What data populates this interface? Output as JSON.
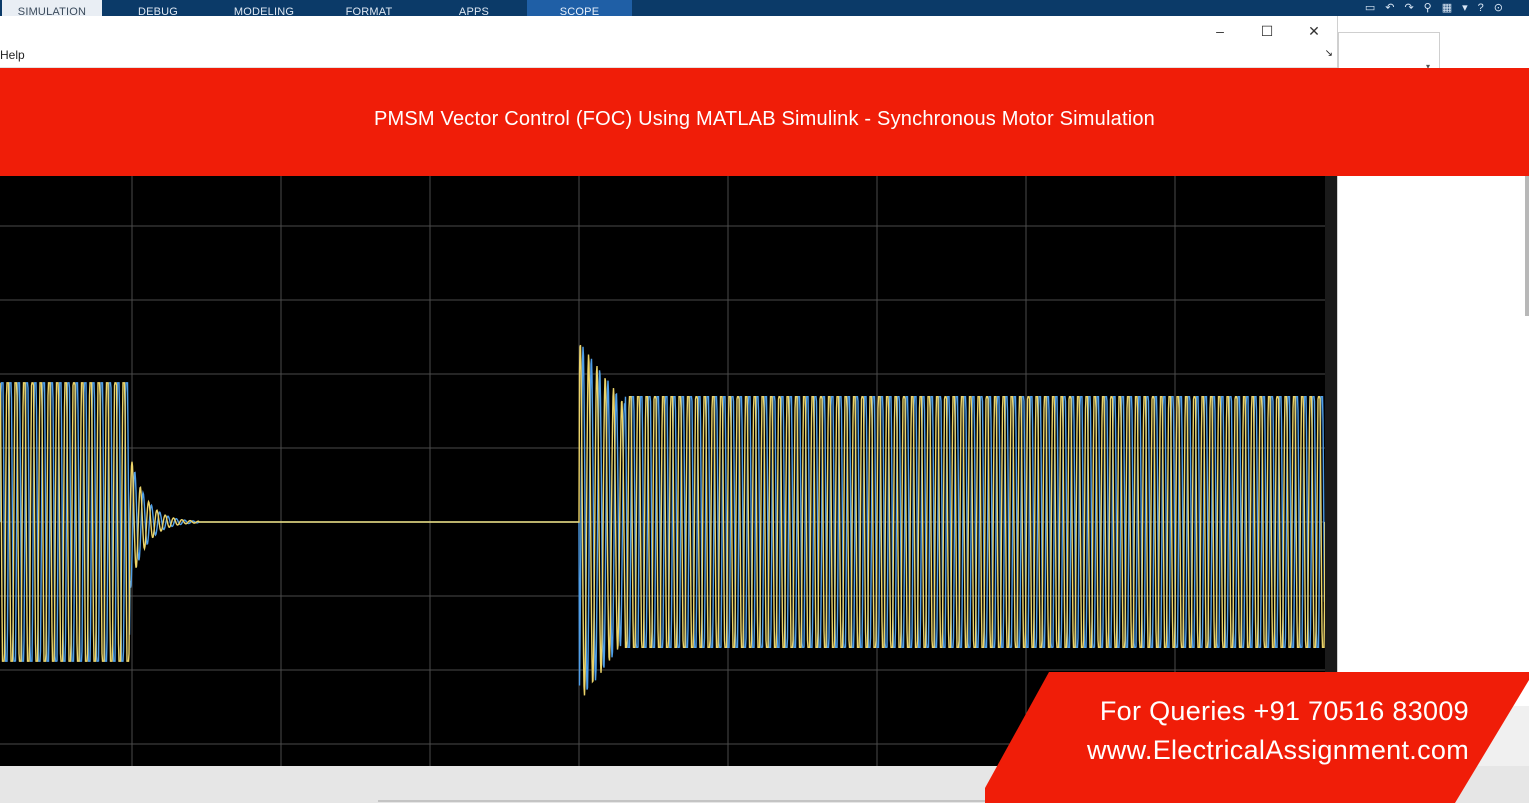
{
  "ribbon": {
    "tabs": [
      {
        "label": "SIMULATION",
        "state": "selected"
      },
      {
        "label": "DEBUG",
        "state": "normal"
      },
      {
        "label": "MODELING",
        "state": "normal"
      },
      {
        "label": "FORMAT",
        "state": "normal"
      },
      {
        "label": "APPS",
        "state": "normal"
      },
      {
        "label": "SCOPE",
        "state": "contextual"
      }
    ],
    "quick_access_icons": [
      "save-icon",
      "undo-icon",
      "redo-icon",
      "search-icon",
      "layout-icon",
      "help-icon",
      "options-icon"
    ],
    "quick_access_glyphs": {
      "save": "▭",
      "undo": "↶",
      "redo": "↷",
      "search": "⚲",
      "layout": "▦",
      "dropdown": "▾",
      "help": "?",
      "options": "⊙"
    }
  },
  "window": {
    "controls": {
      "minimize": "–",
      "maximize": "☐",
      "close": "✕"
    },
    "menu": {
      "help_label": "Help",
      "arrow": "↘"
    }
  },
  "banner": {
    "title": "PMSM Vector Control (FOC) Using MATLAB Simulink - Synchronous Motor Simulation",
    "color": "#f01d08"
  },
  "scope": {
    "background": "#000000",
    "grid_color": "#4a4a4a",
    "series_colors": [
      "#4f9ee8",
      "#ecd46a"
    ],
    "segments": [
      {
        "phase": "steady oscillation",
        "start_fraction": 0.0,
        "end_fraction": 0.098,
        "relative_amplitude": 1.0
      },
      {
        "phase": "decay",
        "start_fraction": 0.098,
        "end_fraction": 0.15,
        "relative_amplitude": 0.5
      },
      {
        "phase": "flat",
        "start_fraction": 0.15,
        "end_fraction": 0.437,
        "relative_amplitude": 0.0
      },
      {
        "phase": "startup transient",
        "start_fraction": 0.437,
        "end_fraction": 0.472,
        "relative_amplitude": 1.3
      },
      {
        "phase": "steady oscillation",
        "start_fraction": 0.472,
        "end_fraction": 1.0,
        "relative_amplitude": 0.9
      }
    ]
  },
  "contact": {
    "queries": "For Queries +91 70516 83009",
    "website": "www.ElectricalAssignment.com"
  }
}
